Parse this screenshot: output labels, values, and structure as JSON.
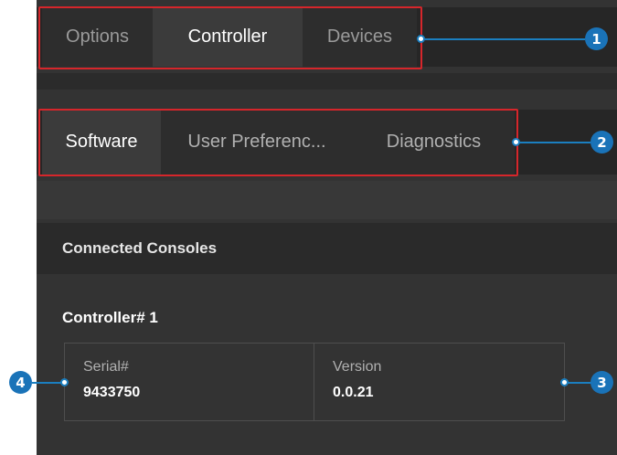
{
  "main_tabs": [
    {
      "label": "Options"
    },
    {
      "label": "Controller"
    },
    {
      "label": "Devices"
    }
  ],
  "sub_tabs": [
    {
      "label": "Software"
    },
    {
      "label": "User Preferenc..."
    },
    {
      "label": "Diagnostics"
    }
  ],
  "section": {
    "header": "Connected Consoles",
    "controller_title": "Controller# 1",
    "serial_label": "Serial#",
    "serial_value": "9433750",
    "version_label": "Version",
    "version_value": "0.0.21"
  },
  "callouts": [
    "1",
    "2",
    "3",
    "4"
  ],
  "colors": {
    "highlight": "#d6262b",
    "callout": "#1a73b8",
    "panel_bg": "#333333"
  }
}
